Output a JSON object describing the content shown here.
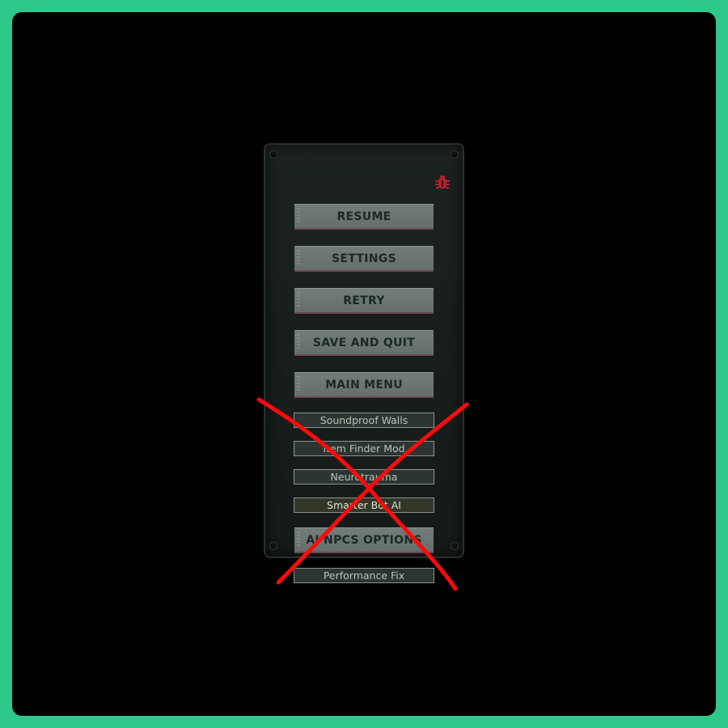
{
  "menu": {
    "buttons": [
      {
        "label": "RESUME"
      },
      {
        "label": "SETTINGS"
      },
      {
        "label": "RETRY"
      },
      {
        "label": "SAVE AND QUIT"
      },
      {
        "label": "MAIN MENU"
      }
    ],
    "mods": [
      {
        "label": "Soundproof Walls"
      },
      {
        "label": "Item Finder Mod"
      },
      {
        "label": "Neurotrauma"
      },
      {
        "label": "Smarter Bot AI"
      }
    ],
    "ainpcs_label": "AI NPCS OPTIONS",
    "performance_label": "Performance Fix"
  },
  "icons": {
    "bug": "bug-report-icon"
  },
  "colors": {
    "outer_background": "#2ec88a",
    "screen_background": "#000000",
    "annotation_cross": "#ff0000",
    "bug_icon": "#b0232b"
  }
}
